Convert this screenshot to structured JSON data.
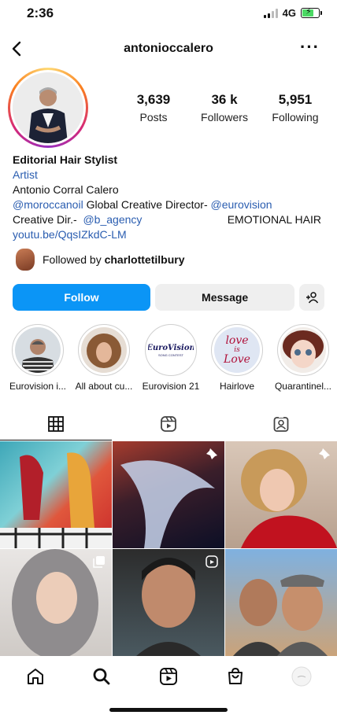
{
  "status": {
    "time": "2:36",
    "network": "4G"
  },
  "nav": {
    "username": "antonioccalero"
  },
  "stats": [
    {
      "value": "3,639",
      "label": "Posts"
    },
    {
      "value": "36 k",
      "label": "Followers"
    },
    {
      "value": "5,951",
      "label": "Following"
    }
  ],
  "bio": {
    "title": "Editorial Hair Stylist",
    "category": "Artist",
    "full_name": "Antonio Corral Calero",
    "line1_mention": "@moroccanoil",
    "line1_text": " Global Creative Director- ",
    "line1_mention2": "@eurovision",
    "line2_prefix": "Creative Dir.-  ",
    "line2_mention": "@b_agency",
    "line2_right": "EMOTIONAL HAIR",
    "link": "youtu.be/QqsIZkdC-LM"
  },
  "followed_by": {
    "prefix": "Followed by ",
    "account": "charlottetilbury"
  },
  "actions": {
    "follow": "Follow",
    "message": "Message"
  },
  "highlights": [
    {
      "label": "Eurovision i..."
    },
    {
      "label": "All about cu..."
    },
    {
      "label": "Eurovision 21"
    },
    {
      "label": "Hairlove"
    },
    {
      "label": "Quarantinel..."
    }
  ],
  "highlight_art": {
    "eurovision_word": "EuroVision",
    "eurovision_sub": "SONG CONTEST",
    "hairlove_line1": "love",
    "hairlove_line2": "is",
    "hairlove_line3": "Love"
  },
  "colors": {
    "accent": "#0b95f6",
    "link": "#2a5db0",
    "button_gray": "#efefef"
  },
  "icons": {
    "tabs": [
      "grid-icon",
      "reels-icon",
      "tagged-icon"
    ],
    "bottom": [
      "home-icon",
      "search-icon",
      "reels-icon",
      "shop-icon",
      "profile-icon"
    ]
  }
}
